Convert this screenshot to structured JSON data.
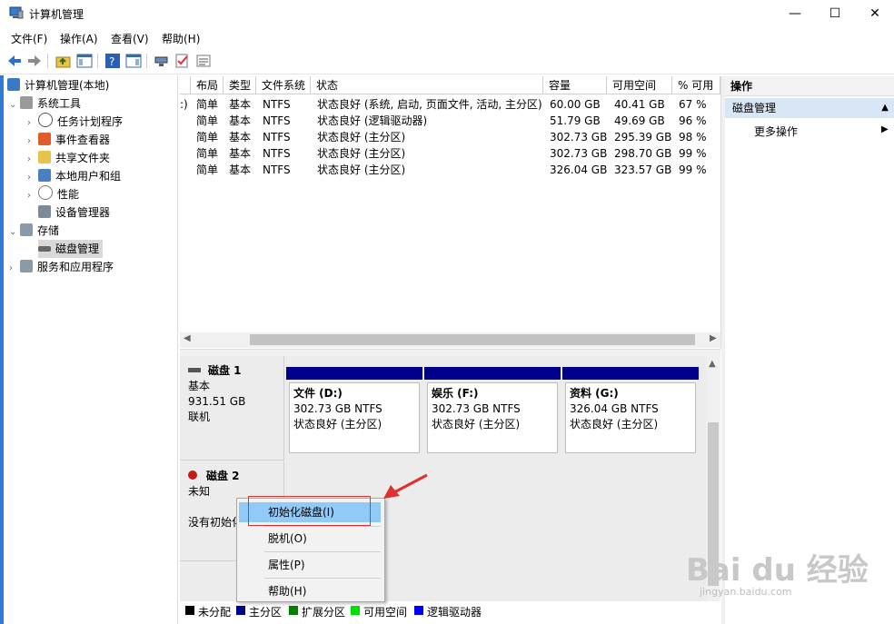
{
  "window": {
    "title": "计算机管理",
    "minimize": "—",
    "maximize": "☐",
    "close": "✕"
  },
  "menu": [
    "文件(F)",
    "操作(A)",
    "查看(V)",
    "帮助(H)"
  ],
  "tree": {
    "root": "计算机管理(本地)",
    "system_tools": "系统工具",
    "items": [
      "任务计划程序",
      "事件查看器",
      "共享文件夹",
      "本地用户和组",
      "性能",
      "设备管理器"
    ],
    "storage": "存储",
    "disk_mgmt": "磁盘管理",
    "services": "服务和应用程序"
  },
  "volumes": {
    "headers": [
      "布局",
      "类型",
      "文件系统",
      "状态",
      "容量",
      "可用空间",
      "% 可用"
    ],
    "rows": [
      {
        "prefix": ":)",
        "layout": "简单",
        "type": "基本",
        "fs": "NTFS",
        "status": "状态良好 (系统, 启动, 页面文件, 活动, 主分区)",
        "cap": "60.00 GB",
        "free": "40.41 GB",
        "pct": "67 %"
      },
      {
        "prefix": "",
        "layout": "简单",
        "type": "基本",
        "fs": "NTFS",
        "status": "状态良好 (逻辑驱动器)",
        "cap": "51.79 GB",
        "free": "49.69 GB",
        "pct": "96 %"
      },
      {
        "prefix": "",
        "layout": "简单",
        "type": "基本",
        "fs": "NTFS",
        "status": "状态良好 (主分区)",
        "cap": "302.73 GB",
        "free": "295.39 GB",
        "pct": "98 %"
      },
      {
        "prefix": "",
        "layout": "简单",
        "type": "基本",
        "fs": "NTFS",
        "status": "状态良好 (主分区)",
        "cap": "302.73 GB",
        "free": "298.70 GB",
        "pct": "99 %"
      },
      {
        "prefix": "",
        "layout": "简单",
        "type": "基本",
        "fs": "NTFS",
        "status": "状态良好 (主分区)",
        "cap": "326.04 GB",
        "free": "323.57 GB",
        "pct": "99 %"
      }
    ]
  },
  "disk1": {
    "name": "磁盘 1",
    "kind": "基本",
    "size": "931.51 GB",
    "state": "联机",
    "partitions": [
      {
        "name": "文件  (D:)",
        "size": "302.73 GB NTFS",
        "status": "状态良好 (主分区)"
      },
      {
        "name": "娱乐  (F:)",
        "size": "302.73 GB NTFS",
        "status": "状态良好 (主分区)"
      },
      {
        "name": "资料  (G:)",
        "size": "326.04 GB NTFS",
        "status": "状态良好 (主分区)"
      }
    ]
  },
  "disk2": {
    "name": "磁盘 2",
    "kind": "未知",
    "state": "没有初始化"
  },
  "legend": [
    {
      "color": "#000000",
      "label": "未分配"
    },
    {
      "color": "#00008b",
      "label": "主分区"
    },
    {
      "color": "#008000",
      "label": "扩展分区"
    },
    {
      "color": "#00e000",
      "label": "可用空间"
    },
    {
      "color": "#0000ff",
      "label": "逻辑驱动器"
    }
  ],
  "actions": {
    "title": "操作",
    "section": "磁盘管理",
    "more": "更多操作"
  },
  "context_menu": {
    "init": "初始化磁盘(I)",
    "offline": "脱机(O)",
    "props": "属性(P)",
    "help": "帮助(H)"
  },
  "watermark": {
    "main": "Bai du 经验",
    "sub": "jingyan.baidu.com"
  }
}
